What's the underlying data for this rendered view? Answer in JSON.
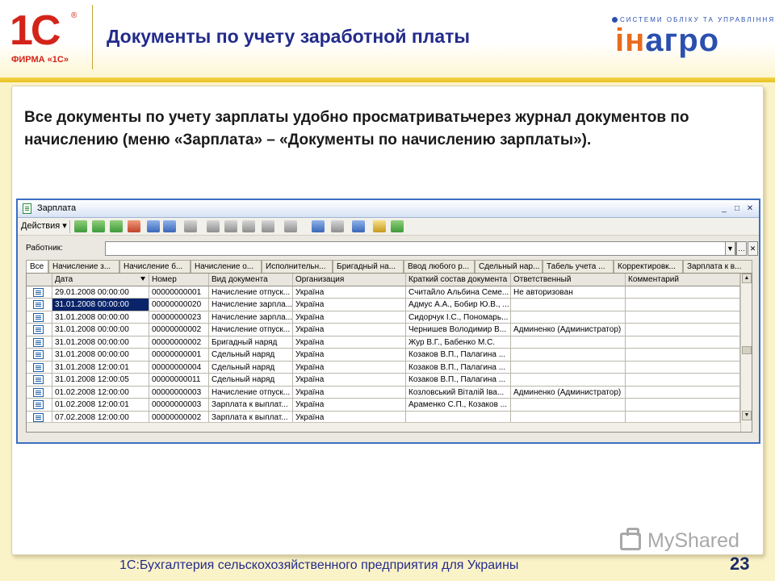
{
  "header": {
    "logo_1c": "1С",
    "logo_1c_caption": "ФИРМА «1С»",
    "title": "Документы по учету заработной платы",
    "partner_tagline": "СИСТЕМИ ОБЛІКУ ТА УПРАВЛІННЯ",
    "partner_logo_prefix": "ін",
    "partner_logo_word": "агро"
  },
  "description": "Все документы по учету зарплаты удобно просматриватьчерез журнал документов по начислению (меню «Зарплата» – «Документы по начислению зарплаты»).",
  "window": {
    "title": "Зарплата",
    "toolbar": {
      "actions_label": "Действия ▾"
    },
    "filter": {
      "label": "Работник:",
      "value": ""
    },
    "tabs": [
      {
        "label": "Все",
        "active": true
      },
      {
        "label": "Начисление з..."
      },
      {
        "label": "Начисление б..."
      },
      {
        "label": "Начисление о..."
      },
      {
        "label": "Исполнительн..."
      },
      {
        "label": "Бригадный на..."
      },
      {
        "label": "Ввод любого р..."
      },
      {
        "label": "Сдельный нар..."
      },
      {
        "label": "Табель учета ..."
      },
      {
        "label": "Корректировк..."
      },
      {
        "label": "Зарплата к в..."
      }
    ],
    "columns": [
      "Дата",
      "Номер",
      "Вид документа",
      "Организация",
      "Краткий состав документа",
      "Ответственный",
      "Комментарий"
    ],
    "rows": [
      [
        "29.01.2008 00:00:00",
        "00000000001",
        "Начисление отпуск...",
        "Україна",
        "Считайло Альбина Семе...",
        "Не авторизован",
        ""
      ],
      [
        "31.01.2008 00:00:00",
        "00000000020",
        "Начисление зарпла...",
        "Україна",
        "Адмус А.А., Бобир Ю.В., ...",
        "",
        ""
      ],
      [
        "31.01.2008 00:00:00",
        "00000000023",
        "Начисление зарпла...",
        "Україна",
        "Сидорчук І.С., Пономарь...",
        "",
        ""
      ],
      [
        "31.01.2008 00:00:00",
        "00000000002",
        "Начисление отпуск...",
        "Україна",
        "Чернишев Володимир В...",
        "Админенко (Администратор)",
        ""
      ],
      [
        "31.01.2008 00:00:00",
        "00000000002",
        "Бригадный наряд",
        "Україна",
        "Жур В.Г., Бабенко М.С.",
        "",
        ""
      ],
      [
        "31.01.2008 00:00:00",
        "00000000001",
        "Сдельный наряд",
        "Україна",
        "Козаков В.П., Палагина ...",
        "",
        ""
      ],
      [
        "31.01.2008 12:00:01",
        "00000000004",
        "Сдельный наряд",
        "Україна",
        "Козаков В.П., Палагина ...",
        "",
        ""
      ],
      [
        "31.01.2008 12:00:05",
        "00000000011",
        "Сдельный наряд",
        "Україна",
        "Козаков В.П., Палагина ...",
        "",
        ""
      ],
      [
        "01.02.2008 12:00:00",
        "00000000003",
        "Начисление отпуск...",
        "Україна",
        "Козловський Віталій Іва...",
        "Админенко (Администратор)",
        ""
      ],
      [
        "01.02.2008 12:00:01",
        "00000000003",
        "Зарплата к выплат...",
        "Україна",
        "Араменко С.П., Козаков ...",
        "",
        ""
      ],
      [
        "07.02.2008 12:00:00",
        "00000000002",
        "Зарплата к выплат...",
        "Україна",
        "",
        "",
        ""
      ]
    ],
    "selected_row": 1
  },
  "watermark": "MyShared",
  "footer": {
    "text": "1С:Бухгалтерия сельскохозяйственного предприятия для Украины",
    "page_number": "23"
  }
}
